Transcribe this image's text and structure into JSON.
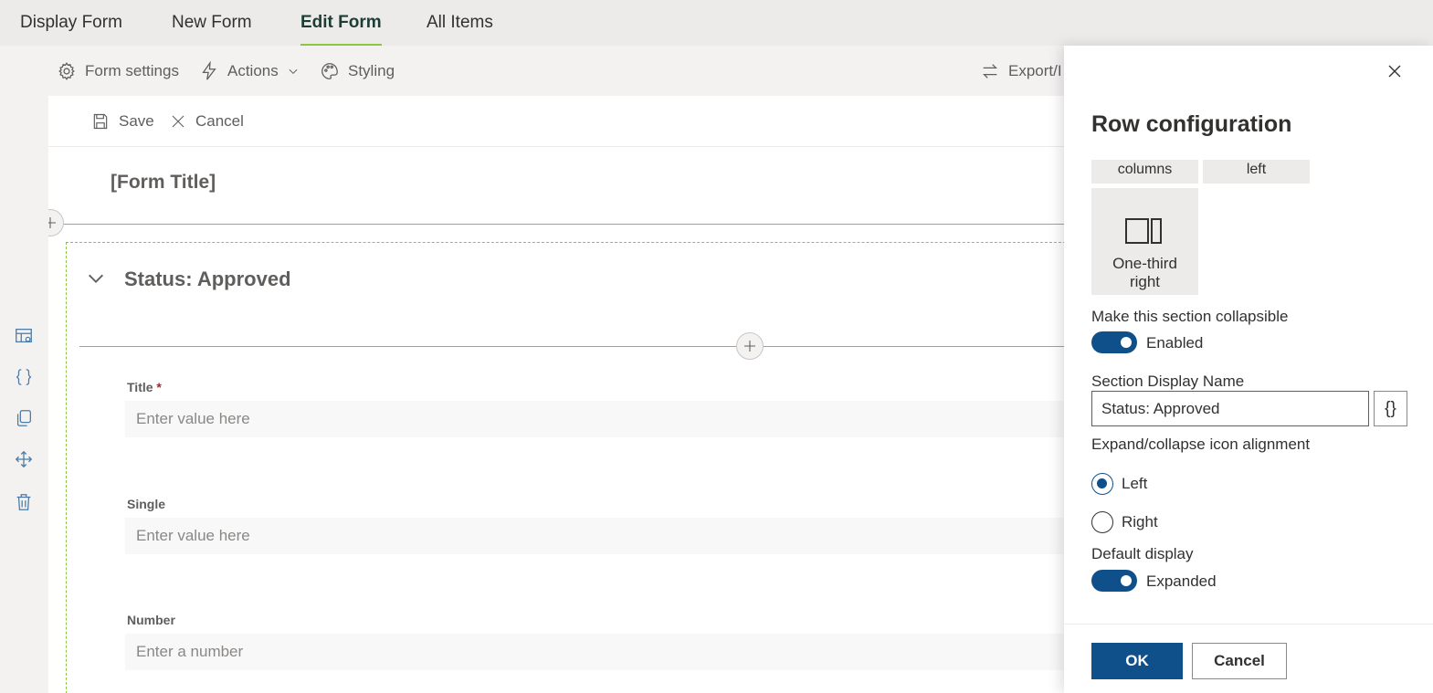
{
  "tabs": [
    {
      "label": "Display Form"
    },
    {
      "label": "New Form"
    },
    {
      "label": "Edit Form",
      "active": true
    },
    {
      "label": "All Items"
    }
  ],
  "toolbar": {
    "form_settings": "Form settings",
    "actions": "Actions",
    "styling": "Styling",
    "export": "Export/I"
  },
  "cmdbar": {
    "save": "Save",
    "cancel": "Cancel"
  },
  "form": {
    "title": "[Form Title]",
    "section_title": "Status: Approved",
    "fields": [
      {
        "label": "Title",
        "required": "*",
        "placeholder": "Enter value here"
      },
      {
        "label": "Single",
        "placeholder": "Enter value here"
      },
      {
        "label": "Number",
        "placeholder": "Enter a number"
      }
    ]
  },
  "panel": {
    "title": "Row configuration",
    "layout_options_top": [
      "columns",
      "left"
    ],
    "layout_card": {
      "line1": "One-third",
      "line2": "right"
    },
    "collapsible_label": "Make this section collapsible",
    "collapsible_state": "Enabled",
    "display_name_label": "Section Display Name",
    "display_name_value": "Status: Approved",
    "fx_label": "{}",
    "alignment_label": "Expand/collapse icon alignment",
    "alignment_options": [
      {
        "label": "Left",
        "checked": true
      },
      {
        "label": "Right",
        "checked": false
      }
    ],
    "default_display_label": "Default display",
    "default_display_state": "Expanded",
    "ok": "OK",
    "cancel": "Cancel"
  },
  "icons": {
    "form_settings": "gear-icon",
    "actions": "lightning-icon",
    "styling": "palette-icon",
    "export": "swap-arrows-icon",
    "save": "save-icon",
    "cancel": "close-icon",
    "rail": [
      "layout-settings-icon",
      "code-braces-icon",
      "copy-icon",
      "move-icon",
      "delete-icon"
    ]
  },
  "colors": {
    "accent": "#0f4f8a",
    "tab_underline": "#8cc63f",
    "section_border": "#8cc63f"
  }
}
